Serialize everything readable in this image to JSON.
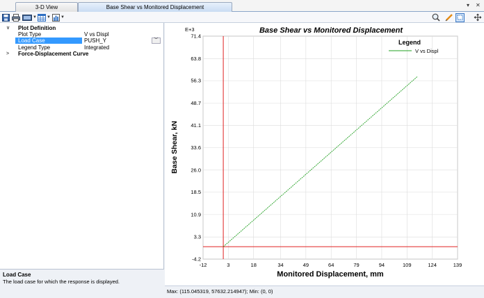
{
  "tabs": [
    {
      "label": "3-D View",
      "active": false
    },
    {
      "label": "Base Shear vs Monitored Displacement",
      "active": true
    }
  ],
  "window_controls": {
    "pin": "▾",
    "close": "✕"
  },
  "properties": {
    "plot_definition": {
      "header": "Plot Definition",
      "rows": [
        {
          "key": "Plot Type",
          "value": "V vs Displ"
        },
        {
          "key": "Load Case",
          "value": "PUSH_Y",
          "selected": true
        },
        {
          "key": "Legend Type",
          "value": "Integrated"
        }
      ]
    },
    "force_displacement": {
      "header": "Force-Displacement Curve"
    }
  },
  "description": {
    "title": "Load Case",
    "text": "The load case for which the response is displayed."
  },
  "status": {
    "text": "Max: (115.045319, 57632.214947);   Min: (0, 0)"
  },
  "colors": {
    "accent": "#3399ff",
    "series": "#22a022",
    "reference_line": "#e02020"
  },
  "chart_data": {
    "type": "line",
    "title": "Base Shear vs Monitored Displacement",
    "xlabel": "Monitored Displacement, mm",
    "ylabel": "Base Shear, kN",
    "y_multiplier": "E+3",
    "xlim": [
      -12,
      139
    ],
    "ylim": [
      -4.2,
      71.4
    ],
    "x_ticks": [
      "-12",
      "3",
      "18",
      "34",
      "49",
      "64",
      "79",
      "94",
      "109",
      "124",
      "139"
    ],
    "y_ticks": [
      "71.4",
      "63.8",
      "56.3",
      "48.7",
      "41.1",
      "33.6",
      "26.0",
      "18.5",
      "10.9",
      "3.3",
      "-4.2"
    ],
    "legend": {
      "title": "Legend",
      "position": "top-right"
    },
    "grid": true,
    "series": [
      {
        "name": "V vs Displ",
        "x": [
          0,
          115.045319
        ],
        "y": [
          0,
          57.632
        ]
      }
    ]
  }
}
